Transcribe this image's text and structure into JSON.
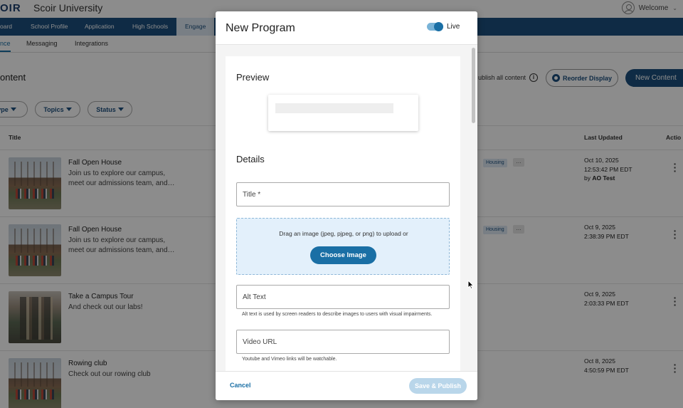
{
  "header": {
    "logo_text": "OIR",
    "org_name": "Scoir University",
    "welcome_label": "Welcome",
    "user_icon": "user-icon",
    "chevron_icon": "chevron-down-icon"
  },
  "nav": {
    "items": [
      {
        "label": "oard"
      },
      {
        "label": "School Profile"
      },
      {
        "label": "Application"
      },
      {
        "label": "High Schools"
      },
      {
        "label": "Engage"
      }
    ],
    "active_index": 4
  },
  "subnav": {
    "items": [
      {
        "label": "nce"
      },
      {
        "label": "Messaging"
      },
      {
        "label": "Integrations"
      }
    ]
  },
  "page": {
    "title": "ontent",
    "publish_all_label": "ublish all content",
    "reorder_label": "Reorder Display",
    "new_content_label": "New Content"
  },
  "filters": [
    {
      "label": "ype"
    },
    {
      "label": "Topics"
    },
    {
      "label": "Status"
    }
  ],
  "table": {
    "columns": {
      "title": "Title",
      "last_updated": "Last Updated",
      "actions": "Actio"
    },
    "rows": [
      {
        "title": "Fall Open House",
        "desc": "Join us to explore our campus, meet our admissions team, and…",
        "tag": "Housing",
        "more": "…",
        "date": "Oct 10, 2025",
        "time": "12:53:42 PM EDT",
        "by_prefix": "by ",
        "by_name": "AO Test"
      },
      {
        "title": "Fall Open House",
        "desc": "Join us to explore our campus, meet our admissions team, and…",
        "tag": "Housing",
        "more": "…",
        "date": "Oct 9, 2025",
        "time": "2:38:39 PM EDT"
      },
      {
        "title": "Take a Campus Tour",
        "desc": "And check out our labs!",
        "date": "Oct 9, 2025",
        "time": "2:03:33 PM EDT"
      },
      {
        "title": "Rowing club",
        "desc": "Check out our rowing club",
        "date": "Oct 8, 2025",
        "time": "4:50:59 PM EDT"
      }
    ]
  },
  "modal": {
    "title": "New Program",
    "live_label": "Live",
    "live_on": true,
    "preview_heading": "Preview",
    "details_heading": "Details",
    "title_field_label": "Title *",
    "dropzone_text": "Drag an image (jpeg, pjpeg, or png) to upload or",
    "choose_image_label": "Choose Image",
    "alt_text_label": "Alt Text",
    "alt_text_helper": "Alt text is used by screen readers to describe images to users with visual impairments.",
    "video_url_label": "Video URL",
    "video_url_helper": "Youtube and Vimeo links will be watchable.",
    "cancel_label": "Cancel",
    "save_publish_label": "Save & Publish"
  },
  "colors": {
    "primary": "#1c4f7e",
    "accent": "#1a6fa5",
    "dropzone_bg": "#e3f0fb",
    "disabled_button": "#b9d6ea"
  }
}
